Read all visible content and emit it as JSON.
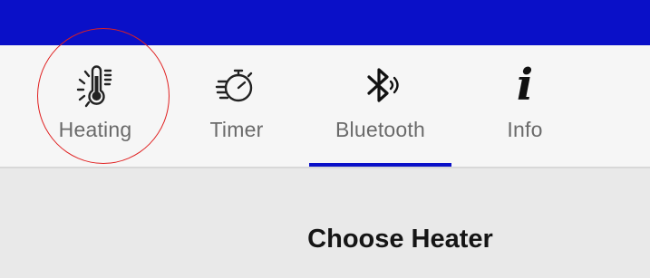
{
  "tabs": [
    {
      "label": "Heating",
      "icon": "thermometer-heat-icon",
      "selected": false
    },
    {
      "label": "Timer",
      "icon": "stopwatch-icon",
      "selected": false
    },
    {
      "label": "Bluetooth",
      "icon": "bluetooth-icon",
      "selected": true
    },
    {
      "label": "Info",
      "icon": "info-icon",
      "glyph": "i",
      "selected": false
    }
  ],
  "content": {
    "heading": "Choose Heater"
  },
  "colors": {
    "app_bar": "#0a10c8",
    "tab_indicator": "#0a10c8",
    "highlight": "#e02020"
  }
}
